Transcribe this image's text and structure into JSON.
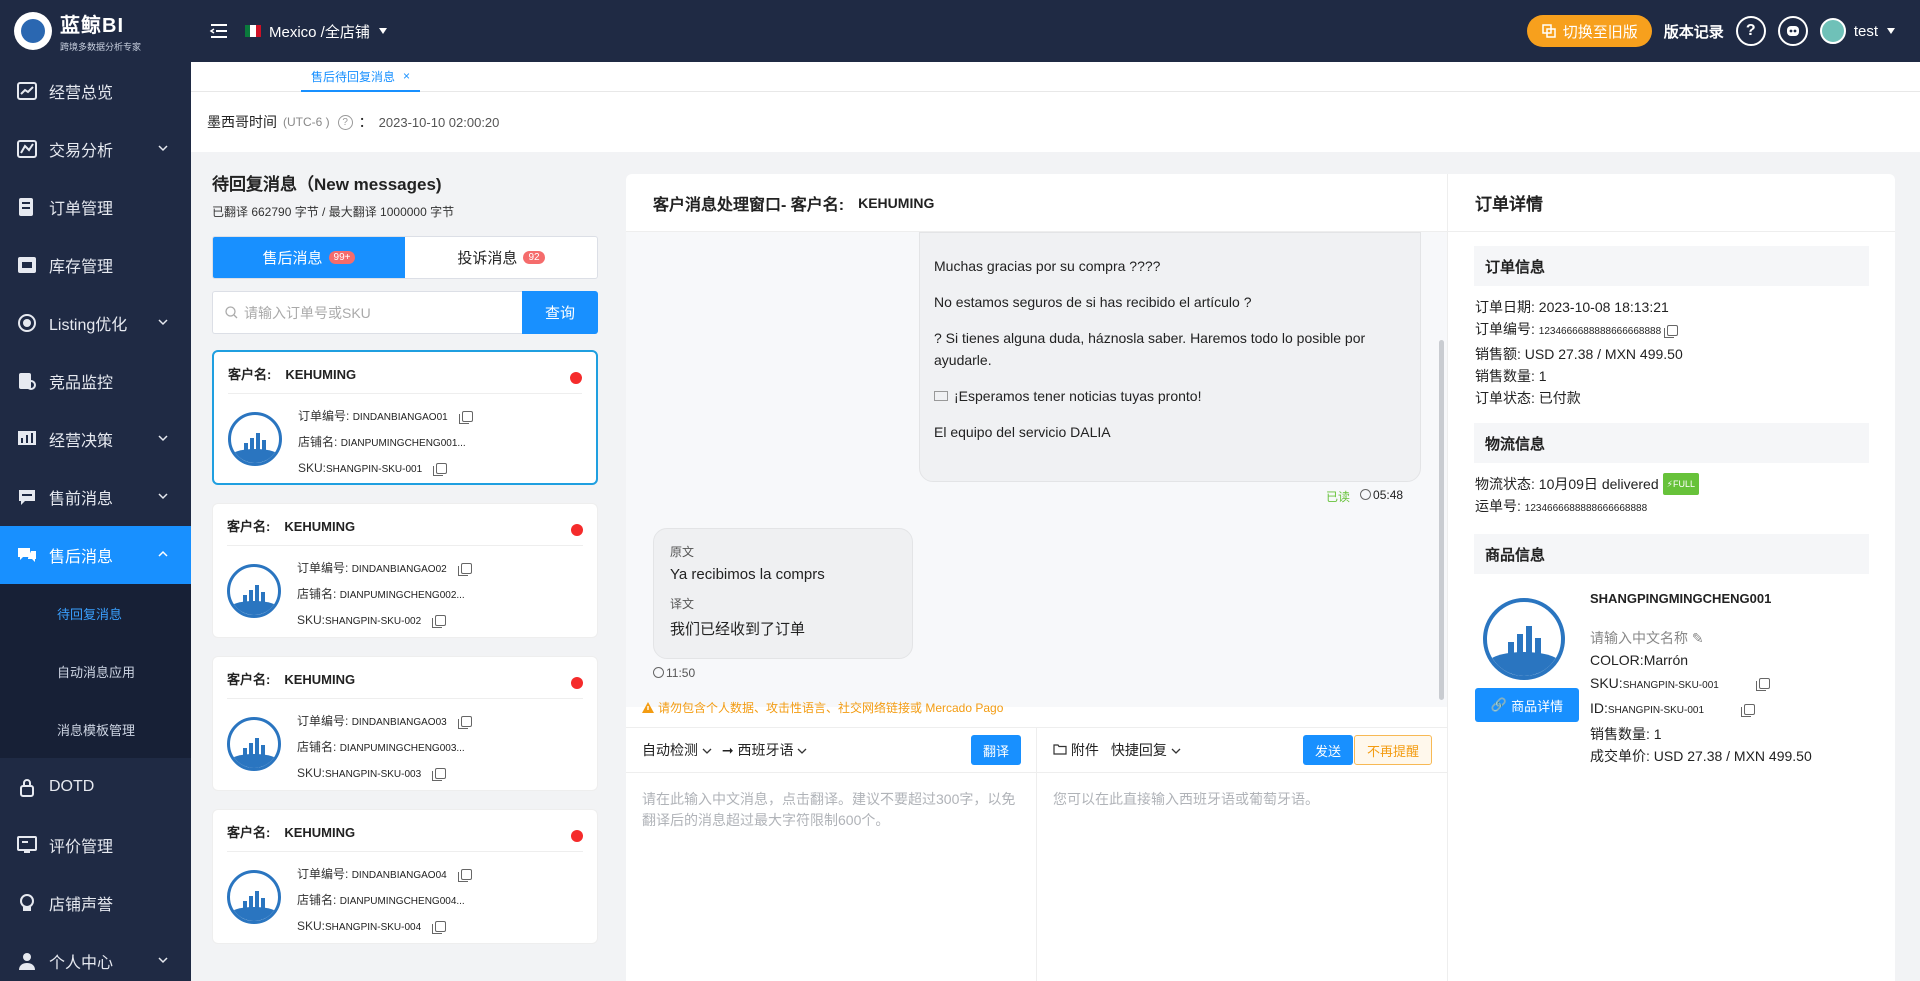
{
  "app": {
    "logo_title": "蓝鲸BI",
    "logo_subtitle": "跨境多数据分析专家"
  },
  "sidebar": {
    "items": [
      {
        "label": "经营总览",
        "icon": "dashboard-icon",
        "has_chevron": false
      },
      {
        "label": "交易分析",
        "icon": "trade-chart-icon",
        "has_chevron": true
      },
      {
        "label": "订单管理",
        "icon": "order-icon",
        "has_chevron": false
      },
      {
        "label": "库存管理",
        "icon": "inventory-icon",
        "has_chevron": false
      },
      {
        "label": "Listing优化",
        "icon": "listing-icon",
        "has_chevron": true
      },
      {
        "label": "竞品监控",
        "icon": "monitor-icon",
        "has_chevron": false
      },
      {
        "label": "经营决策",
        "icon": "decision-icon",
        "has_chevron": true
      },
      {
        "label": "售前消息",
        "icon": "message-icon",
        "has_chevron": true
      },
      {
        "label": "售后消息",
        "icon": "after-sales-icon",
        "has_chevron": true,
        "active": true
      }
    ],
    "sub_items": [
      {
        "label": "待回复消息",
        "active": true
      },
      {
        "label": "自动消息应用"
      },
      {
        "label": "消息模板管理"
      }
    ],
    "bottom_items": [
      {
        "label": "DOTD",
        "icon": "lock-icon"
      },
      {
        "label": "评价管理",
        "icon": "review-icon"
      },
      {
        "label": "店铺声誉",
        "icon": "reputation-icon"
      },
      {
        "label": "个人中心",
        "icon": "user-icon",
        "has_chevron": true
      }
    ]
  },
  "topbar": {
    "store": "Mexico /全店铺",
    "switch_label": "切换至旧版",
    "version_label": "版本记录",
    "help": "?",
    "user": "test",
    "accent": "#f7a01d"
  },
  "tabs": [
    {
      "label": "售后待回复消息",
      "close": "×"
    }
  ],
  "timebar": {
    "label": "墨西哥时间",
    "tz": "(UTC-6 )",
    "colon": "：",
    "value": "2023-10-10 02:00:20"
  },
  "messages": {
    "title": "待回复消息（New messages)",
    "quota": "已翻译 662790 字节 / 最大翻译 1000000 字节",
    "seg": [
      {
        "label": "售后消息",
        "badge": "99+"
      },
      {
        "label": "投诉消息",
        "badge": "92"
      }
    ],
    "search_placeholder": "请输入订单号或SKU",
    "search_button": "查询",
    "cust_label": "客户名:",
    "order_label": "订单编号:",
    "shop_label": "店铺名:",
    "sku_label": "SKU:",
    "cards": [
      {
        "customer": "KEHUMING",
        "order": "DINDANBIANGAO01",
        "shop": "DIANPUMINGCHENG001...",
        "sku": "SHANGPIN-SKU-001"
      },
      {
        "customer": "KEHUMING",
        "order": "DINDANBIANGAO02",
        "shop": "DIANPUMINGCHENG002...",
        "sku": "SHANGPIN-SKU-002"
      },
      {
        "customer": "KEHUMING",
        "order": "DINDANBIANGAO03",
        "shop": "DIANPUMINGCHENG003...",
        "sku": "SHANGPIN-SKU-003"
      },
      {
        "customer": "KEHUMING",
        "order": "DINDANBIANGAO04",
        "shop": "DIANPUMINGCHENG004...",
        "sku": "SHANGPIN-SKU-004"
      }
    ]
  },
  "chat": {
    "title": "客户消息处理窗口- 客户名:",
    "customer": "KEHUMING",
    "outgoing": [
      "Muchas gracias por su compra ????",
      "No estamos seguros de si has recibido el artículo ?",
      "? Si tienes alguna duda, háznosla saber. Haremos todo lo posible por ayudarle.",
      "¡Esperamos tener noticias tuyas pronto!",
      "El equipo del servicio DALIA"
    ],
    "read_status": "已读",
    "out_time": "05:48",
    "incoming": {
      "orig_label": "原文",
      "orig": "Ya recibimos la comprs",
      "trans_label": "译文",
      "trans": "我们已经收到了订单",
      "time": "11:50"
    },
    "warning": "请勿包含个人数据、攻击性语言、社交网络链接或 Mercado Pago",
    "detect": "自动检测",
    "target_lang": "西班牙语",
    "translate_btn": "翻译",
    "attach": "附件",
    "quick_reply": "快捷回复",
    "send_btn": "发送",
    "no_remind_btn": "不再提醒",
    "left_placeholder": "请在此输入中文消息，点击翻译。建议不要超过300字，以免翻译后的消息超过最大字符限制600个。",
    "right_placeholder": "您可以在此直接输入西班牙语或葡萄牙语。"
  },
  "detail": {
    "title": "订单详情",
    "order_info_title": "订单信息",
    "order_date_label": "订单日期:",
    "order_date": "2023-10-08 18:13:21",
    "order_no_label": "订单编号:",
    "order_no": "1234666688888666668888",
    "sales_label": "销售额:",
    "sales": "USD 27.38 / MXN 499.50",
    "qty_label": "销售数量:",
    "qty": "1",
    "status_label": "订单状态:",
    "status": "已付款",
    "logistics_title": "物流信息",
    "log_status_label": "物流状态:",
    "log_status": "10月09日 delivered",
    "full_tag": "FULL",
    "tracking_label": "运单号:",
    "tracking": "1234666688888666668888",
    "product_title": "商品信息",
    "product_name": "SHANGPINGMINGCHENG001",
    "cn_name_hint": "请输入中文名称",
    "color_label": "COLOR:",
    "color": "Marrón",
    "sku_label": "SKU:",
    "sku": "SHANGPIN-SKU-001",
    "id_label": "ID:",
    "id": "SHANGPIN-SKU-001",
    "p_qty_label": "销售数量:",
    "p_qty": "1",
    "price_label": "成交单价:",
    "price": "USD 27.38 / MXN 499.50",
    "product_btn": "商品详情"
  }
}
